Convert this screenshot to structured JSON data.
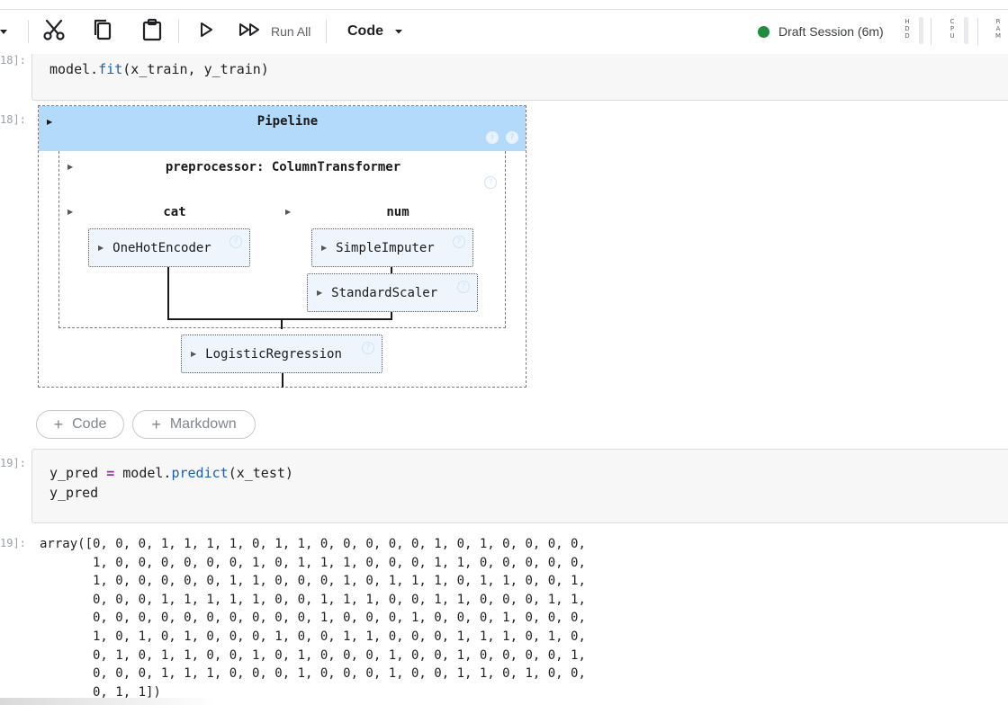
{
  "toolbar": {
    "run_all_label": "Run All",
    "cell_type": "Code",
    "session_text": "Draft Session (6m)",
    "session_status_color": "#1e8e3e",
    "icons": [
      "dropdown-caret-icon",
      "cut-icon",
      "copy-icon",
      "paste-icon",
      "run-icon",
      "run-all-icon",
      "chevron-down-icon"
    ],
    "meters": [
      {
        "label": "HDD",
        "letters": "H\nD\nD"
      },
      {
        "label": "CPU",
        "letters": "C\nP\nU"
      },
      {
        "label": "RAM",
        "letters": "R\nA\nM"
      }
    ]
  },
  "cells": {
    "fit_cell": {
      "prompt": "18]:",
      "code": {
        "obj": "model.",
        "fn": "fit",
        "args": "(x_train, y_train)"
      }
    },
    "fit_output": {
      "prompt": "18]:",
      "pipeline": {
        "title": "Pipeline",
        "preprocessor_title": "preprocessor: ColumnTransformer",
        "branches": [
          {
            "name": "cat",
            "steps": [
              "OneHotEncoder"
            ]
          },
          {
            "name": "num",
            "steps": [
              "SimpleImputer",
              "StandardScaler"
            ]
          }
        ],
        "final_step": "LogisticRegression",
        "info_icons": [
          "info-icon",
          "help-icon"
        ]
      }
    },
    "add_buttons": {
      "code_label": "Code",
      "markdown_label": "Markdown"
    },
    "predict_cell": {
      "prompt": "19]:",
      "line1": {
        "var": "y_pred ",
        "op": "=",
        "obj": " model.",
        "fn": "predict",
        "args": "(x_test)"
      },
      "line2": "y_pred"
    },
    "predict_output": {
      "prompt": "19]:",
      "text": "array([0, 0, 0, 1, 1, 1, 1, 0, 1, 1, 0, 0, 0, 0, 0, 1, 0, 1, 0, 0, 0, 0,\n       1, 0, 0, 0, 0, 0, 0, 1, 0, 1, 1, 1, 0, 0, 0, 1, 1, 0, 0, 0, 0, 0,\n       1, 0, 0, 0, 0, 0, 1, 1, 0, 0, 0, 1, 0, 1, 1, 1, 0, 1, 1, 0, 0, 1,\n       0, 0, 0, 1, 1, 1, 1, 1, 0, 0, 1, 1, 1, 0, 0, 1, 1, 0, 0, 0, 1, 1,\n       0, 0, 0, 0, 0, 0, 0, 0, 0, 0, 1, 0, 0, 0, 1, 0, 0, 0, 1, 0, 0, 0,\n       1, 0, 1, 0, 1, 0, 0, 0, 1, 0, 0, 1, 1, 0, 0, 0, 1, 1, 1, 0, 1, 0,\n       0, 1, 0, 1, 1, 0, 0, 1, 0, 1, 0, 0, 0, 1, 0, 0, 1, 0, 0, 0, 0, 1,\n       0, 0, 0, 1, 1, 1, 0, 0, 0, 1, 0, 0, 0, 1, 0, 0, 1, 1, 0, 1, 0, 0,\n       0, 1, 1])"
    }
  }
}
